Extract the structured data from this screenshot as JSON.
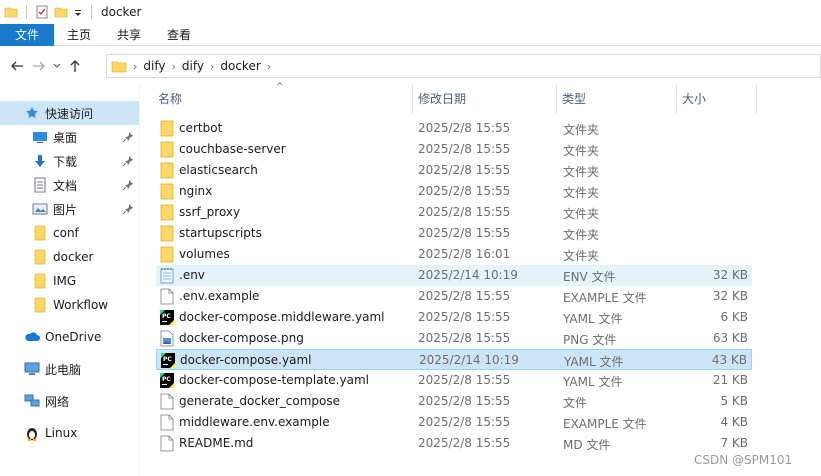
{
  "window": {
    "title": "docker"
  },
  "ribbon": {
    "tabs": [
      "文件",
      "主页",
      "共享",
      "查看"
    ]
  },
  "address": {
    "crumbs": [
      "dify",
      "dify",
      "docker"
    ]
  },
  "sidebar": {
    "items": [
      {
        "label": "快速访问",
        "icon": "star-icon",
        "selected": true,
        "pinned": false
      },
      {
        "label": "桌面",
        "icon": "desktop-icon",
        "pinned": true
      },
      {
        "label": "下载",
        "icon": "download-icon",
        "pinned": true
      },
      {
        "label": "文档",
        "icon": "document-icon",
        "pinned": true
      },
      {
        "label": "图片",
        "icon": "picture-icon",
        "pinned": true
      },
      {
        "label": "conf",
        "icon": "folder-icon",
        "pinned": false
      },
      {
        "label": "docker",
        "icon": "folder-icon",
        "pinned": false
      },
      {
        "label": "IMG",
        "icon": "folder-icon",
        "pinned": false
      },
      {
        "label": "Workflow",
        "icon": "folder-icon",
        "pinned": false
      },
      {
        "label": "OneDrive",
        "icon": "cloud-icon",
        "pinned": false
      },
      {
        "label": "此电脑",
        "icon": "computer-icon",
        "pinned": false
      },
      {
        "label": "网络",
        "icon": "network-icon",
        "pinned": false
      },
      {
        "label": "Linux",
        "icon": "penguin-icon",
        "pinned": false
      }
    ]
  },
  "columns": {
    "name": "名称",
    "date": "修改日期",
    "type": "类型",
    "size": "大小"
  },
  "files": [
    {
      "name": "certbot",
      "date": "2025/2/8 15:55",
      "type": "文件夹",
      "size": "",
      "icon": "folder-icon"
    },
    {
      "name": "couchbase-server",
      "date": "2025/2/8 15:55",
      "type": "文件夹",
      "size": "",
      "icon": "folder-icon"
    },
    {
      "name": "elasticsearch",
      "date": "2025/2/8 15:55",
      "type": "文件夹",
      "size": "",
      "icon": "folder-icon"
    },
    {
      "name": "nginx",
      "date": "2025/2/8 15:55",
      "type": "文件夹",
      "size": "",
      "icon": "folder-icon"
    },
    {
      "name": "ssrf_proxy",
      "date": "2025/2/8 15:55",
      "type": "文件夹",
      "size": "",
      "icon": "folder-icon"
    },
    {
      "name": "startupscripts",
      "date": "2025/2/8 15:55",
      "type": "文件夹",
      "size": "",
      "icon": "folder-icon"
    },
    {
      "name": "volumes",
      "date": "2025/2/8 16:01",
      "type": "文件夹",
      "size": "",
      "icon": "folder-icon"
    },
    {
      "name": ".env",
      "date": "2025/2/14 10:19",
      "type": "ENV 文件",
      "size": "32 KB",
      "icon": "notepad-icon",
      "highlight": true
    },
    {
      "name": ".env.example",
      "date": "2025/2/8 15:55",
      "type": "EXAMPLE 文件",
      "size": "32 KB",
      "icon": "file-icon"
    },
    {
      "name": "docker-compose.middleware.yaml",
      "date": "2025/2/8 15:55",
      "type": "YAML 文件",
      "size": "6 KB",
      "icon": "pycharm-icon"
    },
    {
      "name": "docker-compose.png",
      "date": "2025/2/8 15:55",
      "type": "PNG 文件",
      "size": "63 KB",
      "icon": "image-file-icon"
    },
    {
      "name": "docker-compose.yaml",
      "date": "2025/2/14 10:19",
      "type": "YAML 文件",
      "size": "43 KB",
      "icon": "pycharm-icon",
      "selected": true
    },
    {
      "name": "docker-compose-template.yaml",
      "date": "2025/2/8 15:55",
      "type": "YAML 文件",
      "size": "21 KB",
      "icon": "pycharm-icon"
    },
    {
      "name": "generate_docker_compose",
      "date": "2025/2/8 15:55",
      "type": "文件",
      "size": "5 KB",
      "icon": "file-icon"
    },
    {
      "name": "middleware.env.example",
      "date": "2025/2/8 15:55",
      "type": "EXAMPLE 文件",
      "size": "4 KB",
      "icon": "file-icon"
    },
    {
      "name": "README.md",
      "date": "2025/2/8 15:55",
      "type": "MD 文件",
      "size": "7 KB",
      "icon": "file-icon"
    }
  ],
  "watermark": "CSDN @SPM101",
  "colors": {
    "accent": "#1979ca",
    "selection": "#cde6f7",
    "selection_border": "#99d1ff",
    "folder": "#ffd766"
  }
}
